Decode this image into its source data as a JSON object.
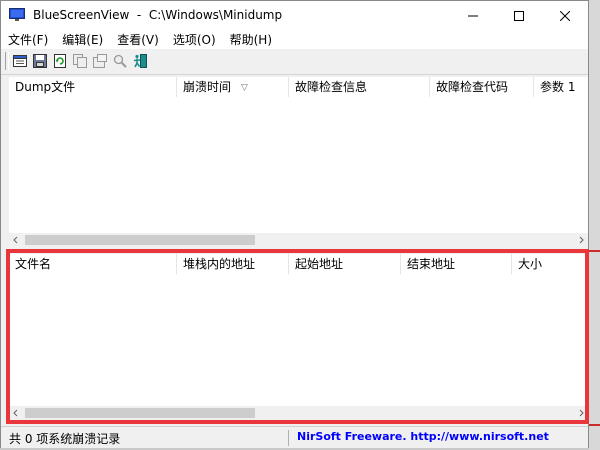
{
  "window": {
    "title": "BlueScreenView  -  C:\\Windows\\Minidump"
  },
  "menu": [
    "文件(F)",
    "编辑(E)",
    "查看(V)",
    "选项(O)",
    "帮助(H)"
  ],
  "toolbar_icons": [
    "properties-icon",
    "save-icon",
    "refresh-icon",
    "copy-icon",
    "options-icon",
    "search-icon",
    "exit-icon"
  ],
  "crash_list": {
    "columns": [
      "Dump文件",
      "崩溃时间",
      "故障检查信息",
      "故障检查代码",
      "参数 1"
    ],
    "sort_indicator": "▽",
    "rows": []
  },
  "driver_list": {
    "columns": [
      "文件名",
      "堆栈内的地址",
      "起始地址",
      "结束地址",
      "大小"
    ],
    "rows": []
  },
  "status": {
    "left": "共 0 项系统崩溃记录",
    "right": "NirSoft Freeware.  http://www.nirsoft.net"
  },
  "colors": {
    "highlight": "#e9363a",
    "link": "#0000ff"
  }
}
